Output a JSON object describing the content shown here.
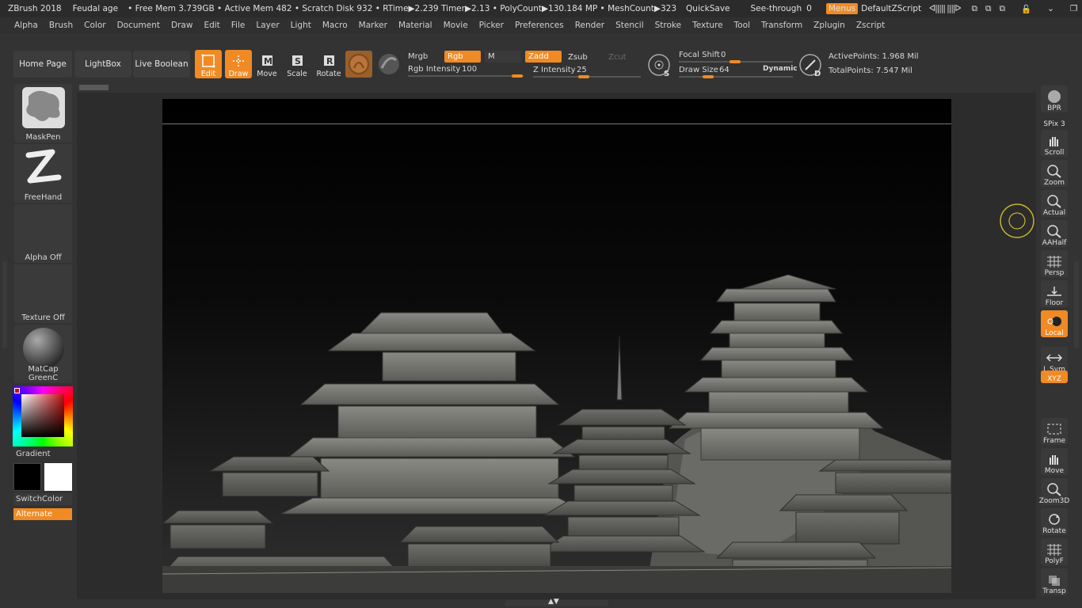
{
  "titlebar": {
    "app": "ZBrush 2018",
    "doc": "Feudal age",
    "status": "• Free Mem 3.739GB • Active Mem 482 • Scratch Disk 932 • RTime▶2.239 Timer▶2.13 • PolyCount▶130.184 MP • MeshCount▶323",
    "quicksave": "QuickSave",
    "seethrough_label": "See-through",
    "seethrough_value": "0",
    "menus": "Menus",
    "script": "DefaultZScript"
  },
  "menubar": [
    "Alpha",
    "Brush",
    "Color",
    "Document",
    "Draw",
    "Edit",
    "File",
    "Layer",
    "Light",
    "Macro",
    "Marker",
    "Material",
    "Movie",
    "Picker",
    "Preferences",
    "Render",
    "Stencil",
    "Stroke",
    "Texture",
    "Tool",
    "Transform",
    "Zplugin",
    "Zscript"
  ],
  "toolbar": {
    "home": "Home Page",
    "lightbox": "LightBox",
    "live_boolean": "Live Boolean",
    "tools": [
      {
        "label": "Edit",
        "icon": "edit-icon"
      },
      {
        "label": "Draw",
        "icon": "draw-icon"
      },
      {
        "label": "Move",
        "icon": "move-icon"
      },
      {
        "label": "Scale",
        "icon": "scale-icon"
      },
      {
        "label": "Rotate",
        "icon": "rotate-icon"
      }
    ],
    "mrgb": "Mrgb",
    "rgb": "Rgb",
    "m": "M",
    "zadd": "Zadd",
    "zsub": "Zsub",
    "zcut": "Zcut",
    "rgb_intensity_label": "Rgb Intensity",
    "rgb_intensity": "100",
    "z_intensity_label": "Z Intensity",
    "z_intensity": "25",
    "focal_shift_label": "Focal Shift",
    "focal_shift": "0",
    "draw_size_label": "Draw Size",
    "draw_size": "64",
    "dynamic": "Dynamic",
    "active_points": "ActivePoints: 1.968 Mil",
    "total_points": "TotalPoints: 7.547 Mil"
  },
  "left_panel": {
    "brush": "MaskPen",
    "stroke": "FreeHand",
    "alpha": "Alpha Off",
    "texture": "Texture Off",
    "material": "MatCap GreenC",
    "gradient": "Gradient",
    "switch_color": "SwitchColor",
    "alternate": "Alternate"
  },
  "right_panel": [
    {
      "label": "BPR",
      "icon": "bpr-sphere-icon"
    },
    {
      "label": "SPix 3",
      "icon": "spix-slider-icon"
    },
    {
      "label": "Scroll",
      "icon": "scroll-hand-icon"
    },
    {
      "label": "Zoom",
      "icon": "zoom-icon"
    },
    {
      "label": "Actual",
      "icon": "actual-zoom-icon"
    },
    {
      "label": "AAHalf",
      "icon": "aahalf-zoom-icon"
    },
    {
      "label": "Persp",
      "icon": "perspective-grid-icon"
    },
    {
      "label": "Floor",
      "icon": "floor-icon"
    },
    {
      "label": "Local",
      "icon": "local-icon"
    },
    {
      "label": "L.Sym",
      "icon": "lsym-icon"
    },
    {
      "label": "XYZ",
      "icon": "xyz-icon"
    },
    {
      "label": "Frame",
      "icon": "frame-icon"
    },
    {
      "label": "Move",
      "icon": "move-hand-icon"
    },
    {
      "label": "Zoom3D",
      "icon": "zoom3d-icon"
    },
    {
      "label": "Rotate",
      "icon": "rotate3d-icon"
    },
    {
      "label": "PolyF",
      "icon": "polyframe-icon"
    },
    {
      "label": "Transp",
      "icon": "transparency-icon"
    }
  ],
  "colors": {
    "accent": "#f08a24",
    "bg": "#333333",
    "canvas": "#000000"
  }
}
